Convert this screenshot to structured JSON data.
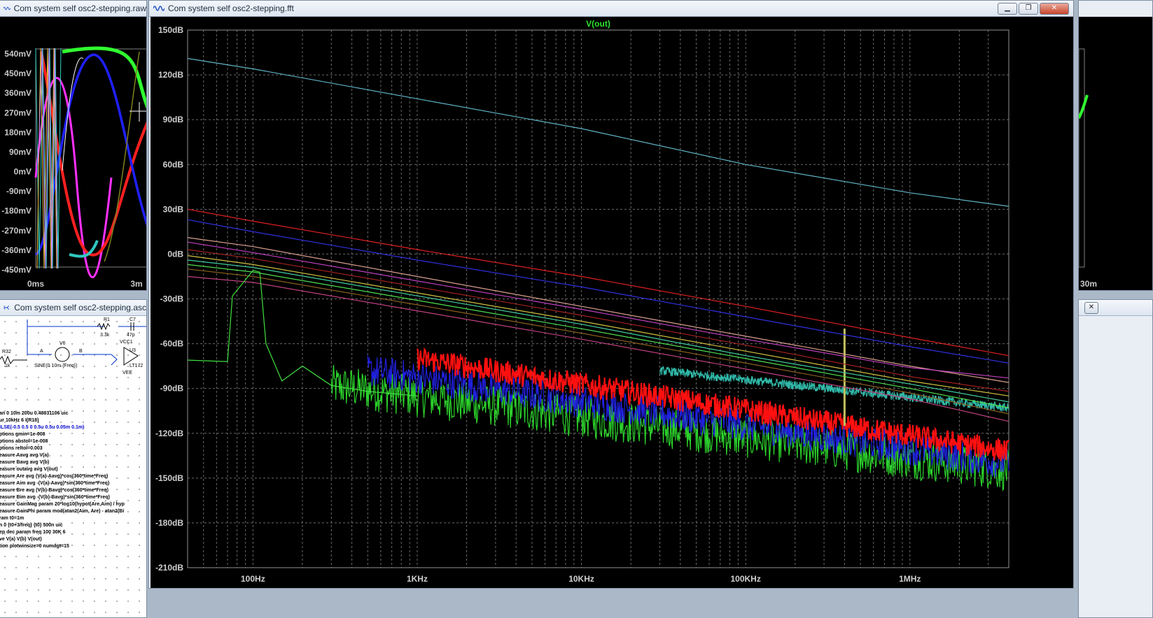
{
  "raw_window": {
    "title": "Com system self osc2-stepping.raw",
    "y_ticks": [
      "540mV",
      "450mV",
      "360mV",
      "270mV",
      "180mV",
      "90mV",
      "0mV",
      "-90mV",
      "-180mV",
      "-270mV",
      "-360mV",
      "-450mV"
    ],
    "x_ticks": [
      "0ms",
      "3m"
    ]
  },
  "asc_window": {
    "title": "Com system self osc2-stepping.asc",
    "components": {
      "r1_name": "R1",
      "r1_value": "3.3k",
      "c7_name": "C7",
      "c7_value": "47p",
      "r32_name": "R32",
      "r32_value": "1k",
      "v6_name": "V6",
      "node_a": "A",
      "node_b": "B",
      "sine": "SINE(0 10m {Freq})",
      "u3_name": "U3",
      "u3_part": "LT172",
      "vcc": "VCC1",
      "vee": "VEE"
    },
    "directives": [
      {
        "text": "an 0 10m 200u 0.48831106 uic",
        "blue": false
      },
      {
        "text": "ur 10kHz 6 I(R18)",
        "blue": false
      },
      {
        "text": "ILSE(-0.5 0.5 0 0.5u 0.5u 0.05m 0.1m)",
        "blue": true
      },
      {
        "text": "ptions gmin=1e-008",
        "blue": false
      },
      {
        "text": "ptions abstol=1e-008",
        "blue": false
      },
      {
        "text": "ptions reltol=0.003",
        "blue": false
      },
      {
        "text": "easure Aavg avg V(a)",
        "blue": false
      },
      {
        "text": "easure Bavg avg V(b)",
        "blue": false
      },
      {
        "text": "easure outavg avg V(out)",
        "blue": false
      },
      {
        "text": "easure Are avg (V(a)-Aavg)*cos(360*time*Freq)",
        "blue": false
      },
      {
        "text": "easure Aim avg -(V(a)-Aavg)*sin(360*time*Freq)",
        "blue": false
      },
      {
        "text": "easure Bre avg (V(b)-Bavg)*cos(360*time*Freq)",
        "blue": false
      },
      {
        "text": "easure Bim avg -(V(b)-Bavg)*sin(360*time*Freq)",
        "blue": false
      },
      {
        "text": "easure GainMag param 20*log10(hypot(Are,Aim) / hyp",
        "blue": false
      },
      {
        "text": "easure GainPhi param mod(atan2(Aim, Are) - atan2(Bi",
        "blue": false
      },
      {
        "text": "ram t0=1m",
        "blue": false
      },
      {
        "text": "n 0 {t0+3/freq} {t0} 500n uic",
        "blue": false
      },
      {
        "text": "ep dec param freq 100 30K 6",
        "blue": false
      },
      {
        "text": "ve V(a) V(b) V(out)",
        "blue": false
      },
      {
        "text": "tion plotwinsize=0 numdgt=15",
        "blue": false
      }
    ]
  },
  "fft_window": {
    "title": "Com system self osc2-stepping.fft",
    "buttons": {
      "minimize": "▁",
      "restore": "❐",
      "close": "✕"
    }
  },
  "chart_data": {
    "type": "line",
    "title": "V(out)",
    "xscale": "log",
    "xlim": [
      40,
      4000000
    ],
    "ylim": [
      -210,
      150
    ],
    "ylabel_unit": "dB",
    "y_ticks": [
      "150dB",
      "120dB",
      "90dB",
      "60dB",
      "30dB",
      "0dB",
      "-30dB",
      "-60dB",
      "-90dB",
      "-120dB",
      "-150dB",
      "-180dB",
      "-210dB"
    ],
    "x_ticks": [
      {
        "f": 100,
        "label": "100Hz"
      },
      {
        "f": 1000,
        "label": "1KHz"
      },
      {
        "f": 10000,
        "label": "10KHz"
      },
      {
        "f": 100000,
        "label": "100KHz"
      },
      {
        "f": 1000000,
        "label": "1MHz"
      }
    ],
    "grid": true,
    "series": [
      {
        "color": "#5fb3c4",
        "points": [
          [
            40,
            131
          ],
          [
            100,
            124
          ],
          [
            1000,
            104
          ],
          [
            10000,
            84
          ],
          [
            100000,
            60
          ],
          [
            1000000,
            41
          ],
          [
            4000000,
            32
          ]
        ]
      },
      {
        "color": "#e02020",
        "points": [
          [
            40,
            30
          ],
          [
            100,
            22
          ],
          [
            1000,
            3
          ],
          [
            10000,
            -15
          ],
          [
            100000,
            -35
          ],
          [
            1000000,
            -56
          ],
          [
            4000000,
            -68
          ]
        ]
      },
      {
        "color": "#3030e0",
        "points": [
          [
            40,
            23
          ],
          [
            100,
            15
          ],
          [
            1000,
            -4
          ],
          [
            10000,
            -22
          ],
          [
            100000,
            -42
          ],
          [
            1000000,
            -62
          ],
          [
            4000000,
            -73
          ]
        ]
      },
      {
        "color": "#d9a090",
        "points": [
          [
            40,
            11
          ],
          [
            100,
            5
          ],
          [
            1000,
            -15
          ],
          [
            10000,
            -35
          ],
          [
            100000,
            -55
          ],
          [
            1000000,
            -75
          ],
          [
            4000000,
            -86
          ]
        ]
      },
      {
        "color": "#c040c0",
        "points": [
          [
            40,
            8
          ],
          [
            100,
            1
          ],
          [
            1000,
            -18
          ],
          [
            10000,
            -37
          ],
          [
            100000,
            -57
          ],
          [
            1000000,
            -76
          ],
          [
            4000000,
            -83
          ]
        ]
      },
      {
        "color": "#a02020",
        "points": [
          [
            40,
            3
          ],
          [
            100,
            -3
          ],
          [
            1000,
            -22
          ],
          [
            10000,
            -41
          ],
          [
            100000,
            -61
          ],
          [
            1000000,
            -82
          ],
          [
            4000000,
            -92
          ]
        ]
      },
      {
        "color": "#d0c040",
        "points": [
          [
            40,
            -1
          ],
          [
            100,
            -7
          ],
          [
            1000,
            -26
          ],
          [
            10000,
            -45
          ],
          [
            100000,
            -65
          ],
          [
            1000000,
            -85
          ],
          [
            4000000,
            -95
          ]
        ]
      },
      {
        "color": "#40d0a0",
        "points": [
          [
            40,
            -4
          ],
          [
            100,
            -9
          ],
          [
            1000,
            -28
          ],
          [
            10000,
            -47
          ],
          [
            100000,
            -68
          ],
          [
            1000000,
            -87
          ],
          [
            4000000,
            -99
          ]
        ]
      },
      {
        "color": "#50e050",
        "points": [
          [
            40,
            -7
          ],
          [
            100,
            -12
          ],
          [
            1000,
            -31
          ],
          [
            10000,
            -50
          ],
          [
            100000,
            -70
          ],
          [
            1000000,
            -90
          ],
          [
            4000000,
            -103
          ]
        ]
      },
      {
        "color": "#8a6020",
        "points": [
          [
            40,
            -10
          ],
          [
            100,
            -15
          ],
          [
            1000,
            -34
          ],
          [
            10000,
            -53
          ],
          [
            100000,
            -73
          ],
          [
            1000000,
            -93
          ],
          [
            4000000,
            -107
          ]
        ]
      },
      {
        "color": "#c04080",
        "points": [
          [
            40,
            -15
          ],
          [
            100,
            -19
          ],
          [
            1000,
            -38
          ],
          [
            10000,
            -57
          ],
          [
            100000,
            -77
          ],
          [
            1000000,
            -97
          ],
          [
            4000000,
            -112
          ]
        ]
      },
      {
        "color": "#40e040",
        "points": [
          [
            40,
            -71
          ],
          [
            70,
            -72
          ],
          [
            75,
            -28
          ],
          [
            100,
            -11
          ],
          [
            110,
            -12
          ],
          [
            120,
            -60
          ],
          [
            150,
            -85
          ],
          [
            200,
            -75
          ],
          [
            300,
            -88
          ],
          [
            500,
            -92
          ],
          [
            1000,
            -95
          ]
        ]
      }
    ],
    "noise": [
      {
        "color": "#2cd42c",
        "from": 300,
        "to": 4000000,
        "base_start": -88,
        "base_end": -145,
        "spread": 14
      },
      {
        "color": "#2020e0",
        "from": 500,
        "to": 4000000,
        "base_start": -78,
        "base_end": -140,
        "spread": 11
      },
      {
        "color": "#ff1010",
        "from": 1000,
        "to": 4000000,
        "base_start": -70,
        "base_end": -132,
        "spread": 8
      },
      {
        "color": "#30b8a8",
        "from": 30000,
        "to": 4000000,
        "base_start": -78,
        "base_end": -103,
        "spread": 3
      }
    ],
    "spike": {
      "f": 400000,
      "top": -50,
      "bottom": -115
    }
  }
}
